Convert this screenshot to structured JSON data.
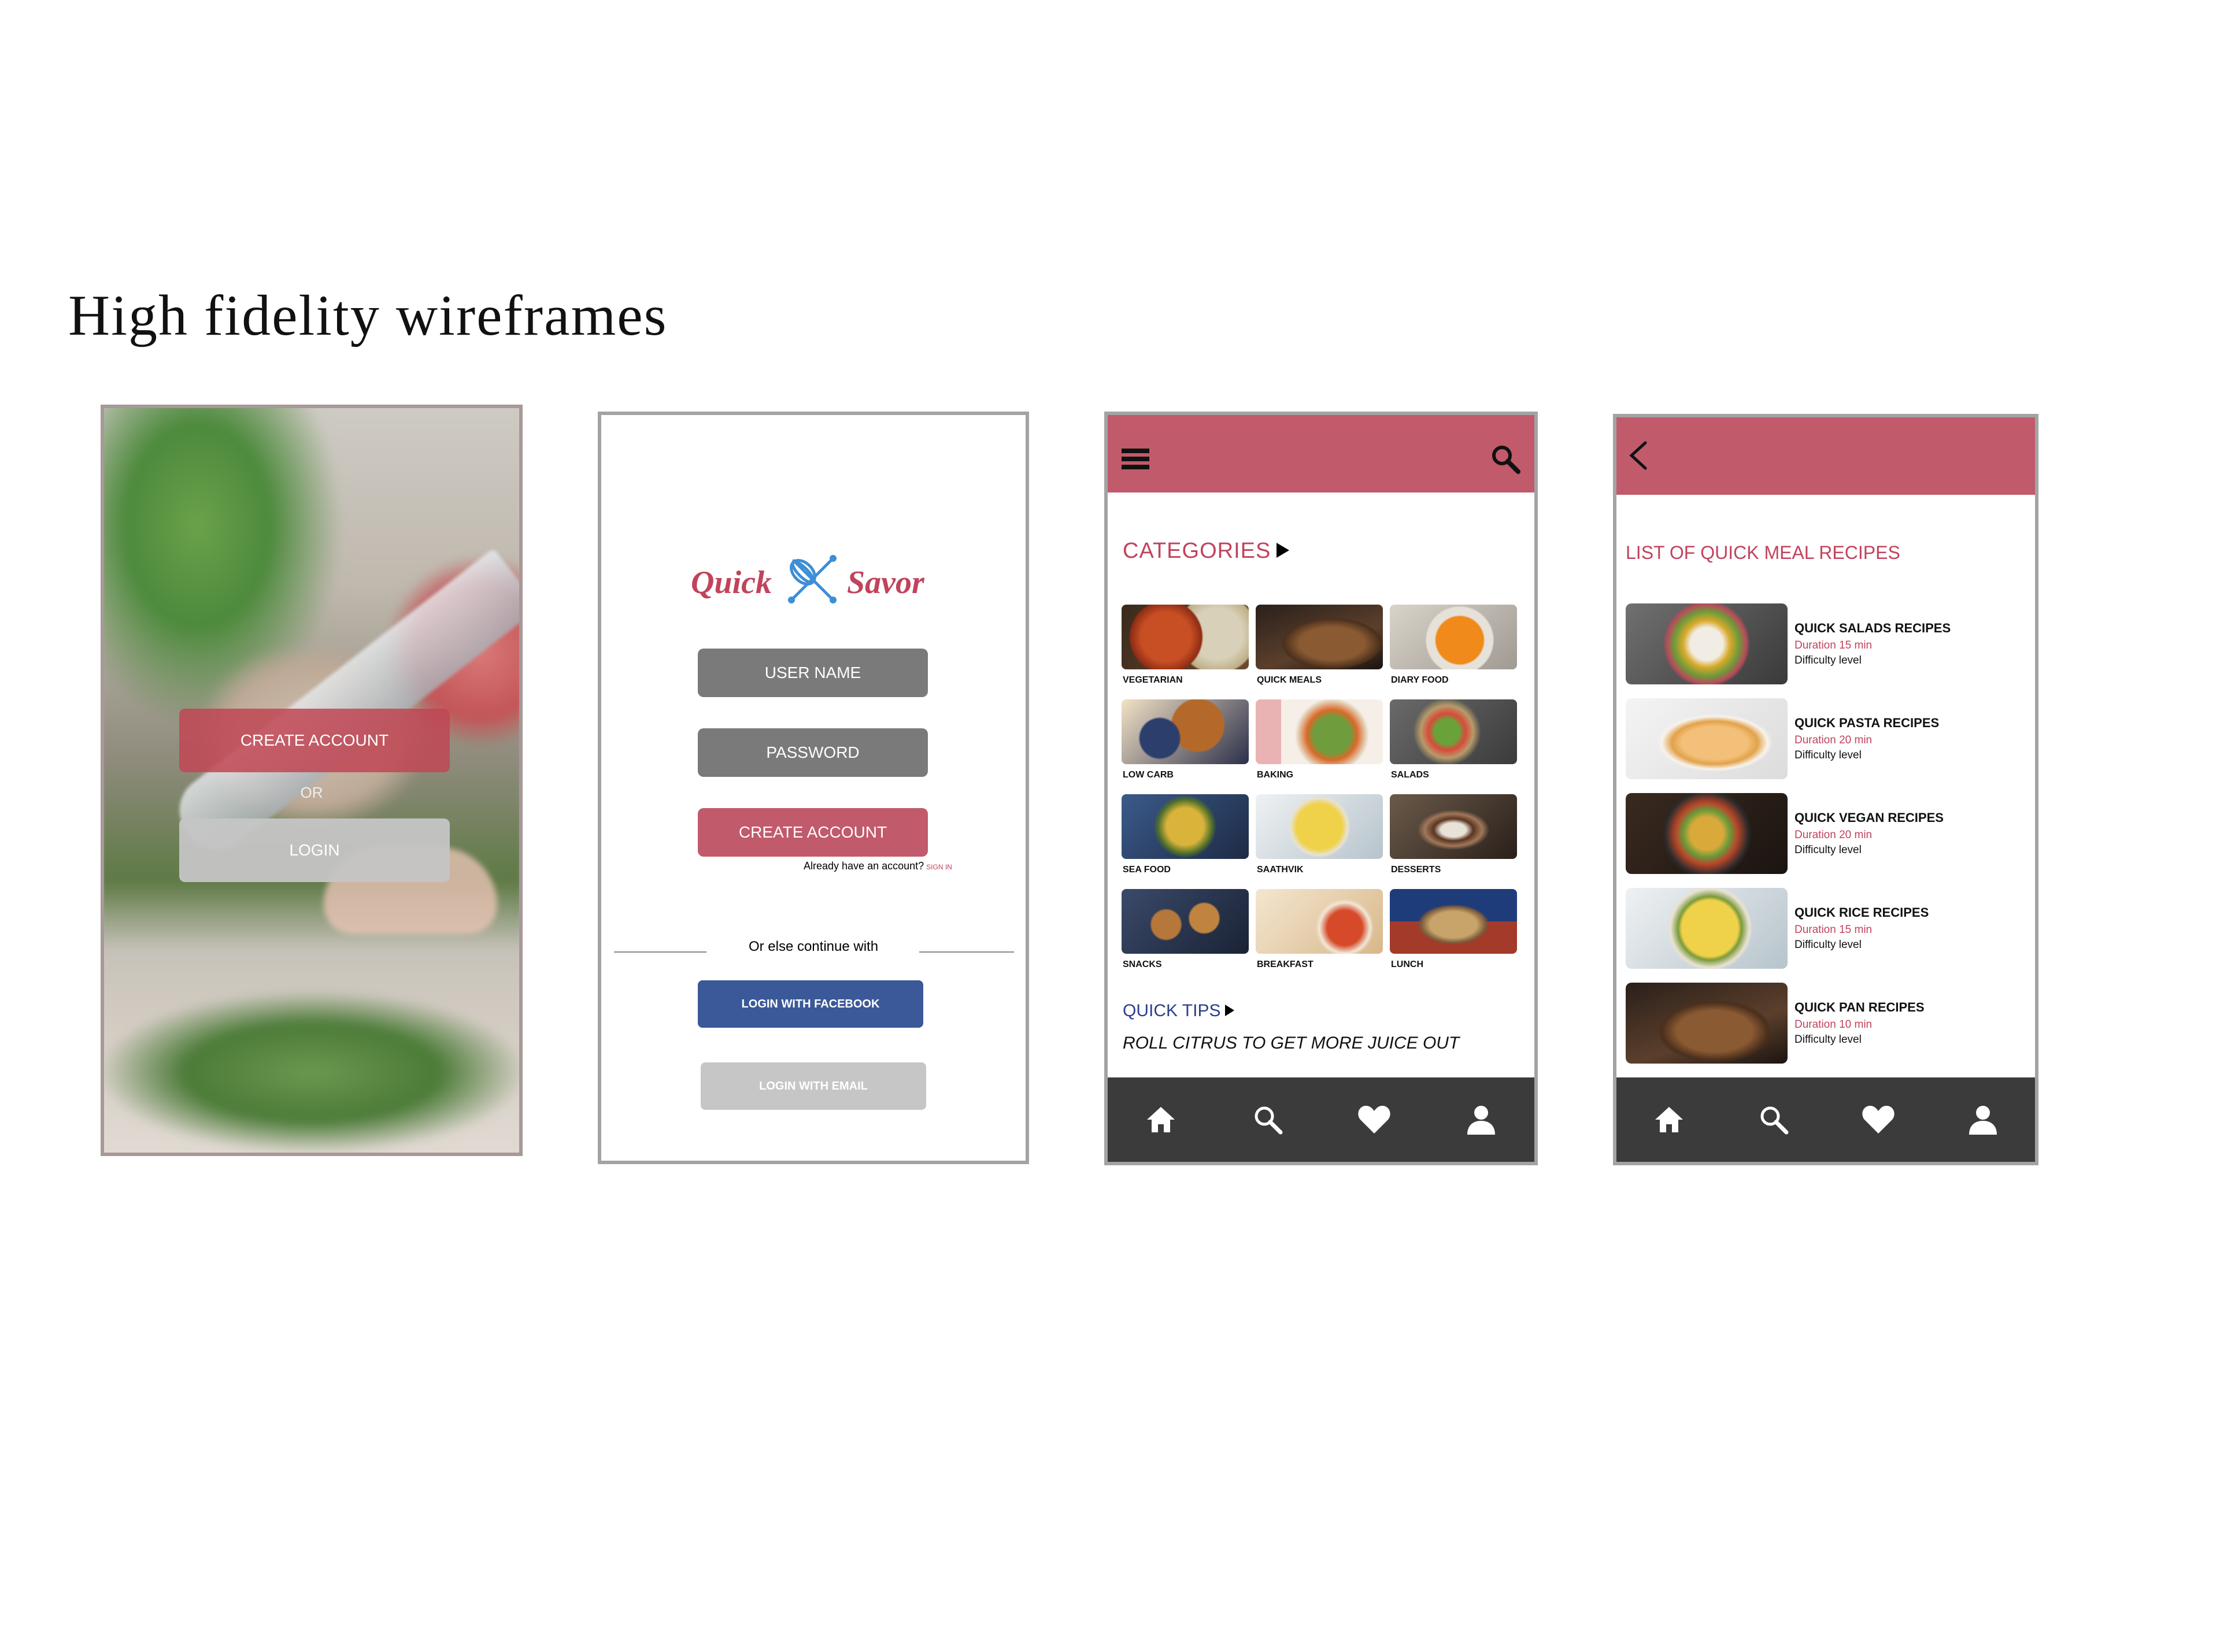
{
  "page_title": "High fidelity wireframes",
  "screen1": {
    "create_account": "CREATE ACCOUNT",
    "or": "OR",
    "login": "LOGIN"
  },
  "screen2": {
    "logo_left": "Quick",
    "logo_right": "Savor",
    "username_field": "USER NAME",
    "password_field": "PASSWORD",
    "create_account": "CREATE ACCOUNT",
    "already_text": "Already have an account?",
    "sign_in": "SIGN IN",
    "continue_text": "Or else continue with",
    "facebook_button": "LOGIN WITH FACEBOOK",
    "email_button": "LOGIN WITH EMAIL"
  },
  "screen3": {
    "categories_title": "CATEGORIES",
    "categories": [
      {
        "label": "VEGETARIAN",
        "icon": "vegetarian-image"
      },
      {
        "label": "QUICK MEALS",
        "icon": "quick-meals-image"
      },
      {
        "label": "DIARY FOOD",
        "icon": "diary-food-image"
      },
      {
        "label": "LOW CARB",
        "icon": "low-carb-image"
      },
      {
        "label": "BAKING",
        "icon": "baking-image"
      },
      {
        "label": "SALADS",
        "icon": "salads-image"
      },
      {
        "label": "SEA FOOD",
        "icon": "sea-food-image"
      },
      {
        "label": "SAATHVIK",
        "icon": "saathvik-image"
      },
      {
        "label": "DESSERTS",
        "icon": "desserts-image"
      },
      {
        "label": "SNACKS",
        "icon": "snacks-image"
      },
      {
        "label": "BREAKFAST",
        "icon": "breakfast-image"
      },
      {
        "label": "LUNCH",
        "icon": "lunch-image"
      }
    ],
    "tips_title": "QUICK TIPS",
    "tips_text": "ROLL CITRUS TO GET MORE JUICE OUT"
  },
  "screen4": {
    "list_title": "LIST OF QUICK MEAL RECIPES",
    "recipes": [
      {
        "name": "QUICK SALADS RECIPES",
        "duration": "Duration  15 min",
        "difficulty": "Difficulty level"
      },
      {
        "name": "QUICK PASTA RECIPES",
        "duration": "Duration  20 min",
        "difficulty": "Difficulty level"
      },
      {
        "name": "QUICK VEGAN RECIPES",
        "duration": "Duration  20 min",
        "difficulty": "Difficulty level"
      },
      {
        "name": "QUICK RICE RECIPES",
        "duration": "Duration  15 min",
        "difficulty": "Difficulty level"
      },
      {
        "name": "QUICK PAN RECIPES",
        "duration": "Duration  10 min",
        "difficulty": "Difficulty level"
      }
    ]
  },
  "nav_icons": [
    "home-icon",
    "search-icon",
    "heart-icon",
    "profile-icon"
  ],
  "colors": {
    "brand": "#c15a6b",
    "accent_text": "#c1435c",
    "nav_bar": "#3b3b3b",
    "facebook": "#3b5998",
    "field_gray": "#7a7a7a",
    "tips_blue": "#2c3e8c"
  }
}
